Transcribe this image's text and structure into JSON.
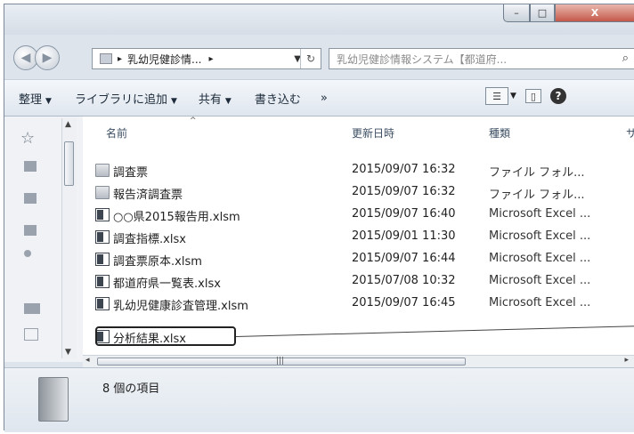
{
  "window": {
    "controls": {
      "minimize": "–",
      "maximize": "□",
      "close": "X"
    }
  },
  "address_bar": {
    "separator": "▸",
    "path": "乳幼児健診情...",
    "after_arrow": "▸",
    "dropdown": "▼",
    "refresh": "↻"
  },
  "search": {
    "placeholder": "乳幼児健診情報システム【都道府...",
    "icon": "search-icon"
  },
  "toolbar": {
    "items": [
      {
        "label": "整理",
        "arrow": "▼"
      },
      {
        "label": "ライブラリに追加",
        "arrow": "▼"
      },
      {
        "label": "共有",
        "arrow": "▼"
      },
      {
        "label": "書き込む",
        "arrow": ""
      },
      {
        "label": "»",
        "arrow": ""
      }
    ],
    "view_button": "☰",
    "view_arrow": "▼",
    "help": "?"
  },
  "columns": {
    "name": "名前",
    "modified": "更新日時",
    "type": "種類",
    "size": "サ"
  },
  "files": [
    {
      "name": "調査票",
      "modified": "2015/09/07 16:32",
      "type": "ファイル フォル...",
      "icon": "folder-icon"
    },
    {
      "name": "報告済調査票",
      "modified": "2015/09/07 16:32",
      "type": "ファイル フォル...",
      "icon": "folder-icon"
    },
    {
      "name": "○○県2015報告用.xlsm",
      "modified": "2015/09/07 16:40",
      "type": "Microsoft Excel ...",
      "icon": "excel-icon"
    },
    {
      "name": "調査指標.xlsx",
      "modified": "2015/09/01 11:30",
      "type": "Microsoft Excel ...",
      "icon": "excel-icon"
    },
    {
      "name": "調査票原本.xlsm",
      "modified": "2015/09/07 16:44",
      "type": "Microsoft Excel ...",
      "icon": "excel-icon"
    },
    {
      "name": "都道府県一覧表.xlsx",
      "modified": "2015/07/08 10:32",
      "type": "Microsoft Excel ...",
      "icon": "excel-icon"
    },
    {
      "name": "乳幼児健康診査管理.xlsm",
      "modified": "2015/09/07 16:45",
      "type": "Microsoft Excel ...",
      "icon": "excel-icon"
    },
    {
      "name": "分析結果.xlsx",
      "modified": "",
      "type": "",
      "icon": "excel-icon"
    }
  ],
  "status": {
    "item_count": "8 個の項目"
  }
}
